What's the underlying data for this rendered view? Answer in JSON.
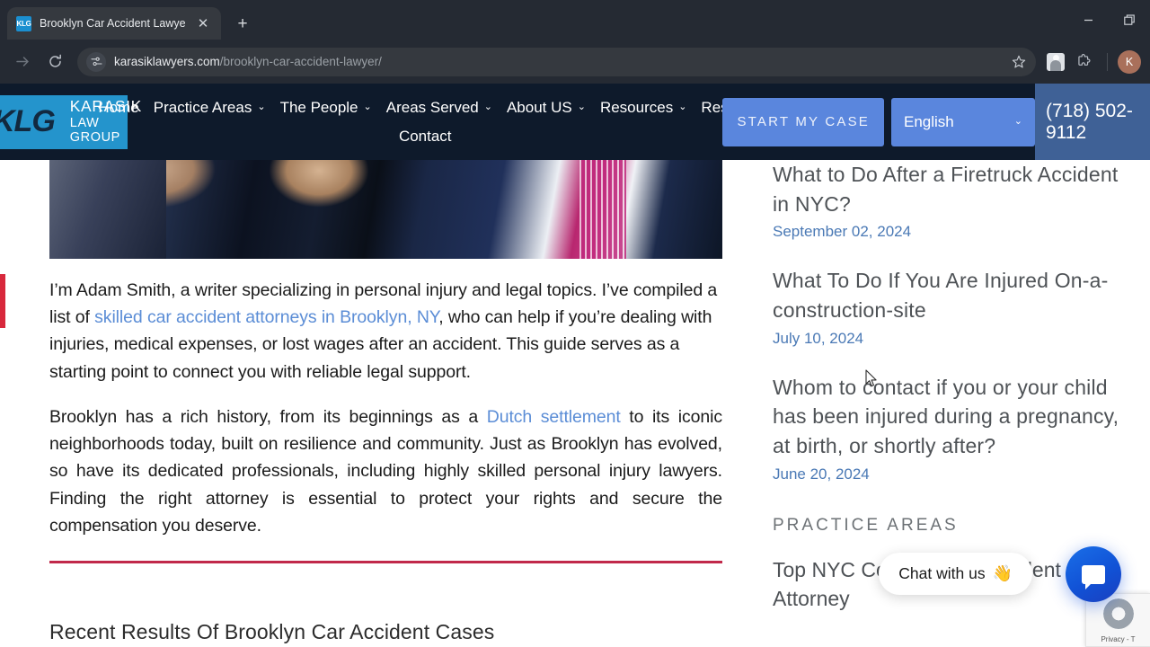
{
  "browser": {
    "tab": {
      "title": "Brooklyn Car Accident Lawyer |",
      "favicon_label": "KLG",
      "close_label": "✕"
    },
    "new_tab_label": "+",
    "window_controls": {
      "minimize": "—",
      "restore": "❐"
    },
    "toolbar": {
      "forward": "→",
      "reload": "⟳",
      "url_domain": "karasiklawyers.com",
      "url_path": "/brooklyn-car-accident-lawyer/",
      "bookmark_label": "☆",
      "profile_initial": "K"
    }
  },
  "site": {
    "logo": {
      "mark": "KLG",
      "line1": "KARASIK",
      "line2": "LAW GROUP"
    },
    "nav_row1": [
      {
        "label": "Home",
        "caret": false
      },
      {
        "label": "Practice Areas",
        "caret": true
      },
      {
        "label": "The People",
        "caret": true
      },
      {
        "label": "Areas Served",
        "caret": true
      },
      {
        "label": "About US",
        "caret": true
      },
      {
        "label": "Resources",
        "caret": true
      },
      {
        "label": "Results",
        "caret": false
      }
    ],
    "nav_row2": [
      {
        "label": "Contact",
        "caret": false
      }
    ],
    "cta_label": "START MY CASE",
    "language": {
      "selected": "English",
      "caret": "⌄"
    },
    "phone": "(718) 502-9112",
    "colors": {
      "header_bg": "#0e1a2b",
      "logo_blue": "#2494cc",
      "cta_blue": "#5a86dd",
      "phone_bg": "#3f6196",
      "link_blue": "#5b8dd6",
      "accent_red": "#c1294a",
      "date_blue": "#4a79b5"
    }
  },
  "main": {
    "hero_image_alt": "two men in suits shaking hands",
    "paragraphs": [
      {
        "before": "I’m Adam Smith, a writer specializing in personal injury and legal topics. I’ve compiled a list of ",
        "link": "skilled car accident attorneys in Brooklyn, NY",
        "after": ", who can help if you’re dealing with injuries, medical expenses, or lost wages after an accident. This guide serves as a starting point to connect you with reliable legal support."
      },
      {
        "before": "Brooklyn has a rich history, from its beginnings as a ",
        "link": "Dutch settlement",
        "after": " to its iconic neighborhoods today, built on resilience and community. Just as Brooklyn has evolved, so have its dedicated professionals, including highly skilled personal injury lawyers. Finding the right attorney is essential to protect your rights and secure the compensation you deserve."
      }
    ],
    "section_title": "Recent Results Of Brooklyn Car Accident Cases"
  },
  "sidebar": {
    "posts": [
      {
        "title": "What to Do After a Firetruck Accident in NYC?",
        "date": "September 02, 2024"
      },
      {
        "title": "What To Do If You Are Injured On-a-construction-site",
        "date": "July 10, 2024"
      },
      {
        "title": "Whom to contact if you or your child has been injured during a pregnancy, at birth, or shortly after?",
        "date": "June 20, 2024"
      }
    ],
    "practice_areas_heading": "PRACTICE AREAS",
    "practice_areas": [
      "Top NYC Construction Accident Attorney"
    ]
  },
  "widgets": {
    "chat": {
      "label": "Chat with us",
      "emoji": "👋"
    },
    "recaptcha": {
      "text": "Privacy - T"
    }
  }
}
